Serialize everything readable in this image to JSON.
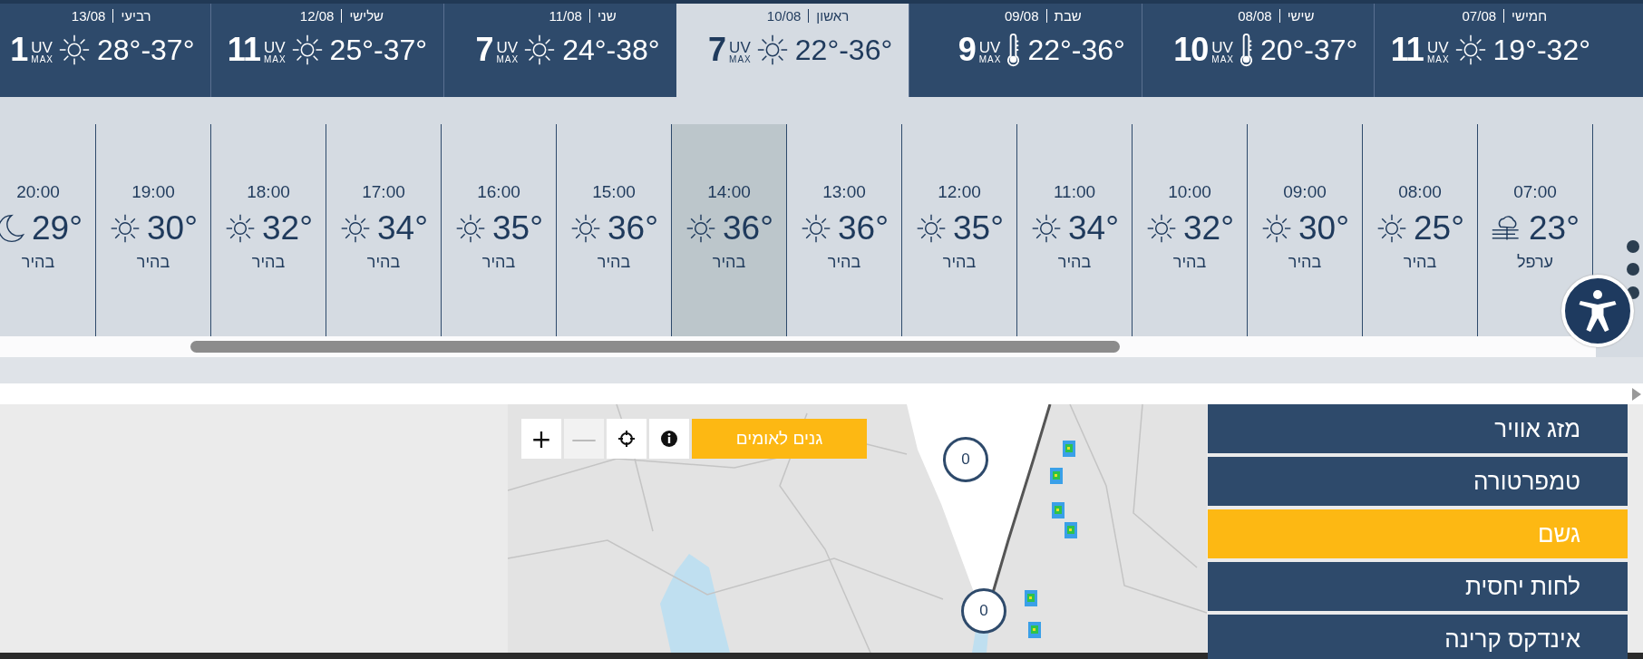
{
  "days": [
    {
      "day": "חמישי",
      "date": "07/08",
      "uv": "11",
      "uv_label": "UV",
      "uv_max_label": "MAX",
      "kind": "sun",
      "range": "19°-32°",
      "selected": false
    },
    {
      "day": "שישי",
      "date": "08/08",
      "uv": "10",
      "uv_label": "UV",
      "uv_max_label": "MAX",
      "kind": "thermometer",
      "range": "20°-37°",
      "selected": false
    },
    {
      "day": "שבת",
      "date": "09/08",
      "uv": "9",
      "uv_label": "UV",
      "uv_max_label": "MAX",
      "kind": "thermometer",
      "range": "22°-36°",
      "selected": false
    },
    {
      "day": "ראשון",
      "date": "10/08",
      "uv": "7",
      "uv_label": "UV",
      "uv_max_label": "MAX",
      "kind": "sun",
      "range": "22°-36°",
      "selected": true
    },
    {
      "day": "שני",
      "date": "11/08",
      "uv": "7",
      "uv_label": "UV",
      "uv_max_label": "MAX",
      "kind": "sun",
      "range": "24°-38°",
      "selected": false
    },
    {
      "day": "שלישי",
      "date": "12/08",
      "uv": "11",
      "uv_label": "UV",
      "uv_max_label": "MAX",
      "kind": "sun",
      "range": "25°-37°",
      "selected": false
    },
    {
      "day": "רביעי",
      "date": "13/08",
      "uv": "1",
      "uv_label": "UV",
      "uv_max_label": "MAX",
      "kind": "sun",
      "range": "28°-37°",
      "selected": false
    }
  ],
  "hours": [
    {
      "time": "07:00",
      "kind": "fog",
      "temp": "23°",
      "condition": "ערפל",
      "selected": false
    },
    {
      "time": "08:00",
      "kind": "sun",
      "temp": "25°",
      "condition": "בהיר",
      "selected": false
    },
    {
      "time": "09:00",
      "kind": "sun",
      "temp": "30°",
      "condition": "בהיר",
      "selected": false
    },
    {
      "time": "10:00",
      "kind": "sun",
      "temp": "32°",
      "condition": "בהיר",
      "selected": false
    },
    {
      "time": "11:00",
      "kind": "sun",
      "temp": "34°",
      "condition": "בהיר",
      "selected": false
    },
    {
      "time": "12:00",
      "kind": "sun",
      "temp": "35°",
      "condition": "בהיר",
      "selected": false
    },
    {
      "time": "13:00",
      "kind": "sun",
      "temp": "36°",
      "condition": "בהיר",
      "selected": false
    },
    {
      "time": "14:00",
      "kind": "sun",
      "temp": "36°",
      "condition": "בהיר",
      "selected": true
    },
    {
      "time": "15:00",
      "kind": "sun",
      "temp": "36°",
      "condition": "בהיר",
      "selected": false
    },
    {
      "time": "16:00",
      "kind": "sun",
      "temp": "35°",
      "condition": "בהיר",
      "selected": false
    },
    {
      "time": "17:00",
      "kind": "sun",
      "temp": "34°",
      "condition": "בהיר",
      "selected": false
    },
    {
      "time": "18:00",
      "kind": "sun",
      "temp": "32°",
      "condition": "בהיר",
      "selected": false
    },
    {
      "time": "19:00",
      "kind": "sun",
      "temp": "30°",
      "condition": "בהיר",
      "selected": false
    },
    {
      "time": "20:00",
      "kind": "moon",
      "temp": "29°",
      "condition": "בהיר",
      "selected": false
    }
  ],
  "map": {
    "kind": "picture",
    "controls": [
      {
        "kind": "info",
        "disabled": false
      },
      {
        "kind": "locate",
        "disabled": false
      },
      {
        "kind": "text",
        "label": "—",
        "disabled": true
      },
      {
        "kind": "text",
        "label": "+",
        "disabled": false
      }
    ],
    "layer_button": "גנים לאומים",
    "markers": [
      {
        "count": "0"
      },
      {
        "count": "0"
      }
    ]
  },
  "menu": [
    {
      "label": "מזג אוויר",
      "selected": false
    },
    {
      "label": "טמפרטורה",
      "selected": false
    },
    {
      "label": "גשם",
      "selected": true
    },
    {
      "label": "לחות יחסית",
      "selected": false
    },
    {
      "label": "אינדקס קרינה",
      "selected": false
    }
  ]
}
